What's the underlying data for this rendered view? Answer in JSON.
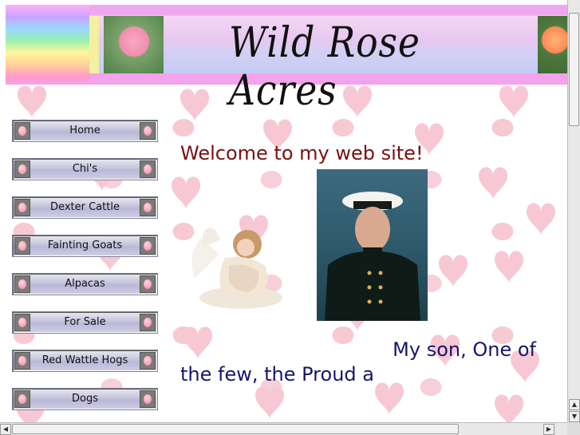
{
  "banner": {
    "title": "Wild Rose Acres"
  },
  "nav": {
    "items": [
      {
        "label": "Home"
      },
      {
        "label": "Chi's"
      },
      {
        "label": "Dexter Cattle"
      },
      {
        "label": "Fainting Goats"
      },
      {
        "label": "Alpacas"
      },
      {
        "label": "For Sale"
      },
      {
        "label": "Red Wattle Hogs"
      },
      {
        "label": "Dogs"
      }
    ]
  },
  "main": {
    "welcome": "Welcome to my web site!",
    "caption_line1": "My son, One of",
    "caption_line2": "the few, the Proud a"
  },
  "colors": {
    "welcome": "#7a1010",
    "caption": "#16166c",
    "banner_pink": "#f0a6ee"
  }
}
